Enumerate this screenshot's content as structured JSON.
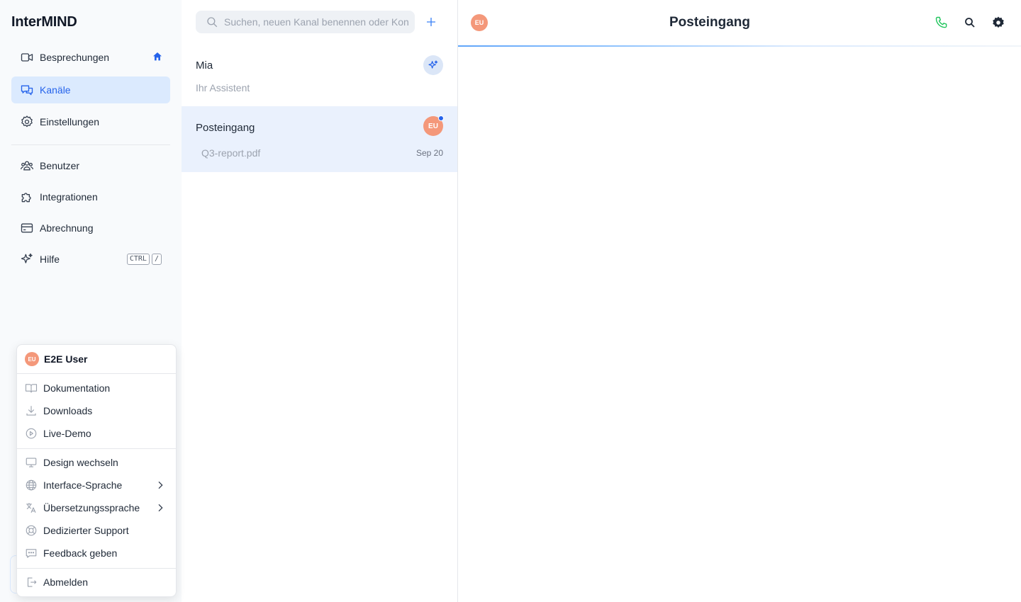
{
  "brand": "InterMIND",
  "sidebar": {
    "items": [
      {
        "label": "Besprechungen"
      },
      {
        "label": "Kanäle"
      },
      {
        "label": "Einstellungen"
      },
      {
        "label": "Benutzer"
      },
      {
        "label": "Integrationen"
      },
      {
        "label": "Abrechnung"
      },
      {
        "label": "Hilfe",
        "shortcut": [
          "CTRL",
          "/"
        ]
      }
    ]
  },
  "search": {
    "placeholder": "Suchen, neuen Kanal benennen oder Kontakt hinzufügen"
  },
  "channels": [
    {
      "name": "Mia",
      "subtitle": "Ihr Assistent"
    },
    {
      "name": "Posteingang",
      "subtitle": "Q3-report.pdf",
      "date": "Sep 20",
      "avatar": "EU"
    }
  ],
  "main": {
    "title": "Posteingang",
    "avatar": "EU"
  },
  "user_menu": {
    "avatar": "EU",
    "user_name": "E2E User",
    "items": [
      {
        "label": "Dokumentation"
      },
      {
        "label": "Downloads"
      },
      {
        "label": "Live-Demo"
      },
      {
        "label": "Design wechseln"
      },
      {
        "label": "Interface-Sprache"
      },
      {
        "label": "Übersetzungssprache"
      },
      {
        "label": "Dedizierter Support"
      },
      {
        "label": "Feedback geben"
      },
      {
        "label": "Abmelden"
      }
    ]
  },
  "colors": {
    "accent": "#2563eb",
    "active_bg": "#dbeafe",
    "avatar": "#f4987a",
    "phone": "#22c55e"
  }
}
